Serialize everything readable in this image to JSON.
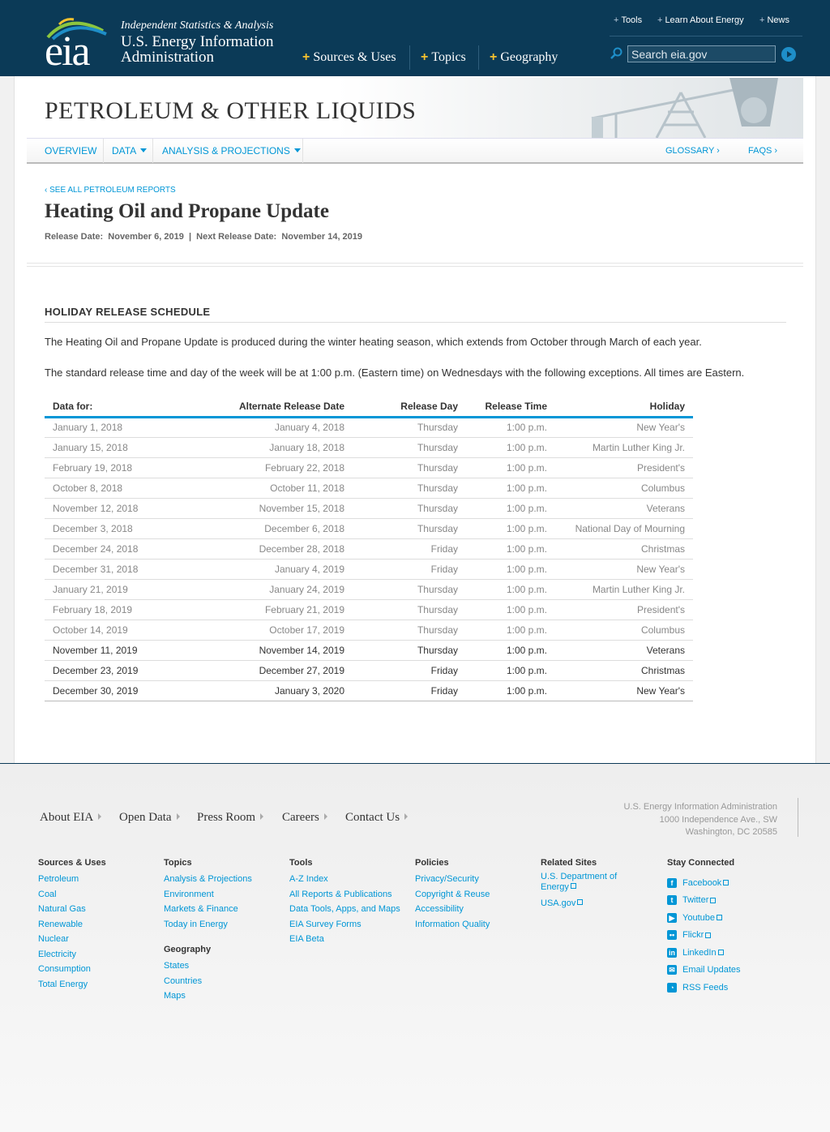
{
  "header": {
    "logo_text": "eia",
    "tagline": "Independent Statistics & Analysis",
    "agency_name": "U.S. Energy Information Administration",
    "top_links": [
      "Tools",
      "Learn About Energy",
      "News"
    ],
    "main_nav": [
      "Sources & Uses",
      "Topics",
      "Geography"
    ],
    "search_placeholder": "Search eia.gov"
  },
  "section": {
    "title": "PETROLEUM & OTHER LIQUIDS",
    "subnav_left": [
      "OVERVIEW",
      "DATA",
      "ANALYSIS & PROJECTIONS"
    ],
    "subnav_right": [
      "GLOSSARY ›",
      "FAQS ›"
    ]
  },
  "report": {
    "back_link": "‹ SEE ALL PETROLEUM REPORTS",
    "title": "Heating Oil and Propane Update",
    "release_label": "Release Date:",
    "release_date": "November 6, 2019",
    "separator": "|",
    "next_label": "Next Release Date:",
    "next_date": "November 14, 2019"
  },
  "schedule": {
    "heading": "HOLIDAY RELEASE SCHEDULE",
    "para1": "The Heating Oil and Propane Update is produced during the winter heating season, which extends from October through March of each year.",
    "para2": "The standard release time and day of the week will be at 1:00 p.m. (Eastern time) on Wednesdays with the following exceptions. All times are Eastern.",
    "columns": [
      "Data for:",
      "Alternate Release Date",
      "Release Day",
      "Release Time",
      "Holiday"
    ],
    "rows": [
      [
        "January 1, 2018",
        "January 4, 2018",
        "Thursday",
        "1:00 p.m.",
        "New Year's"
      ],
      [
        "January 15, 2018",
        "January 18, 2018",
        "Thursday",
        "1:00 p.m.",
        "Martin Luther King Jr."
      ],
      [
        "February 19, 2018",
        "February 22, 2018",
        "Thursday",
        "1:00 p.m.",
        "President's"
      ],
      [
        "October 8, 2018",
        "October 11, 2018",
        "Thursday",
        "1:00 p.m.",
        "Columbus"
      ],
      [
        "November 12, 2018",
        "November 15, 2018",
        "Thursday",
        "1:00 p.m.",
        "Veterans"
      ],
      [
        "December 3, 2018",
        "December 6, 2018",
        "Thursday",
        "1:00 p.m.",
        "National Day of Mourning"
      ],
      [
        "December 24, 2018",
        "December 28, 2018",
        "Friday",
        "1:00 p.m.",
        "Christmas"
      ],
      [
        "December 31, 2018",
        "January 4, 2019",
        "Friday",
        "1:00 p.m.",
        "New Year's"
      ],
      [
        "January 21, 2019",
        "January 24, 2019",
        "Thursday",
        "1:00 p.m.",
        "Martin Luther King Jr."
      ],
      [
        "February 18, 2019",
        "February 21, 2019",
        "Thursday",
        "1:00 p.m.",
        "President's"
      ],
      [
        "October 14, 2019",
        "October 17, 2019",
        "Thursday",
        "1:00 p.m.",
        "Columbus"
      ],
      [
        "November 11, 2019",
        "November 14, 2019",
        "Thursday",
        "1:00 p.m.",
        "Veterans"
      ],
      [
        "December 23, 2019",
        "December 27, 2019",
        "Friday",
        "1:00 p.m.",
        "Christmas"
      ],
      [
        "December 30, 2019",
        "January 3, 2020",
        "Friday",
        "1:00 p.m.",
        "New Year's"
      ]
    ],
    "past_row_count": 11
  },
  "footer": {
    "main_links": [
      "About EIA",
      "Open Data",
      "Press Room",
      "Careers",
      "Contact Us"
    ],
    "address": [
      "U.S. Energy Information Administration",
      "1000 Independence Ave., SW",
      "Washington, DC 20585"
    ],
    "columns": [
      {
        "heading": "Sources & Uses",
        "links": [
          "Petroleum",
          "Coal",
          "Natural Gas",
          "Renewable",
          "Nuclear",
          "Electricity",
          "Consumption",
          "Total Energy"
        ]
      },
      {
        "heading": "Topics",
        "links": [
          "Analysis & Projections",
          "Environment",
          "Markets & Finance",
          "Today in Energy"
        ],
        "heading2": "Geography",
        "links2": [
          "States",
          "Countries",
          "Maps"
        ]
      },
      {
        "heading": "Tools",
        "links": [
          "A-Z Index",
          "All Reports & Publications",
          "Data Tools, Apps, and Maps",
          "EIA Survey Forms",
          "EIA Beta"
        ]
      },
      {
        "heading": "Policies",
        "links": [
          "Privacy/Security",
          "Copyright & Reuse",
          "Accessibility",
          "Information Quality"
        ]
      },
      {
        "heading": "Related Sites",
        "links": [
          "U.S. Department of Energy",
          "USA.gov"
        ]
      },
      {
        "heading": "Stay Connected",
        "links": [
          "Facebook",
          "Twitter",
          "Youtube",
          "Flickr",
          "LinkedIn",
          "Email Updates",
          "RSS Feeds"
        ]
      }
    ]
  },
  "colors": {
    "header_bg": "#0b3a57",
    "accent": "#0096d6",
    "plus": "#f6c22e"
  }
}
